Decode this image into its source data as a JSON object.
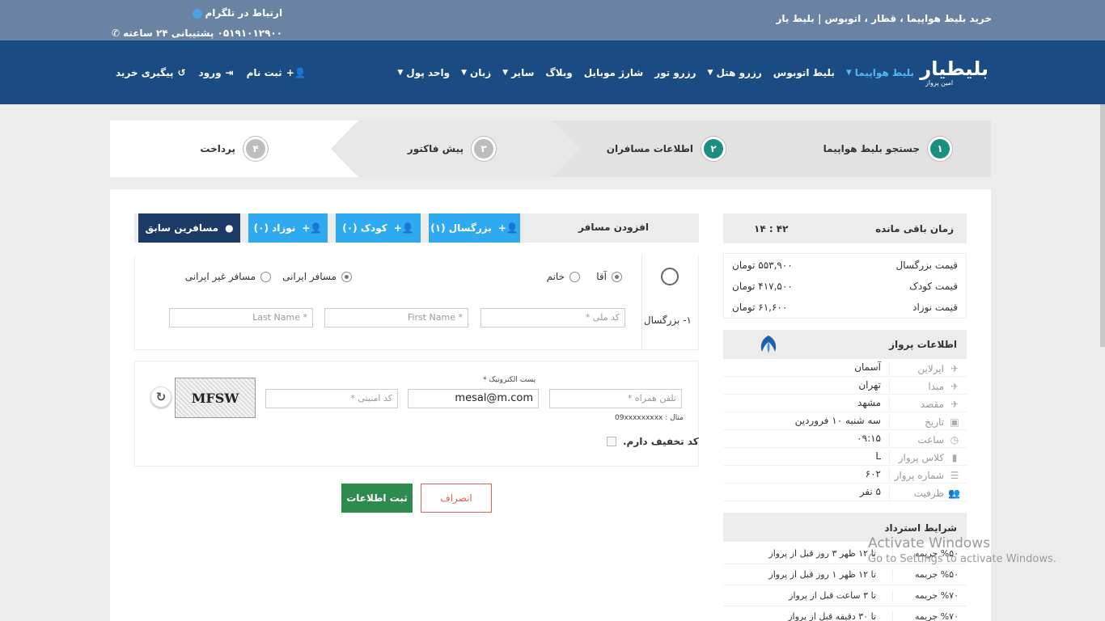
{
  "topbar": {
    "site_title": "خرید بلیط هواپیما ، قطار ، اتوبوس  |  بلیط یار",
    "telegram": "ارتباط در تلگرام",
    "support": "۰۵۱۹۱۰۱۲۹۰۰ پشتیبانی ۲۴ ساعته"
  },
  "logo": {
    "name": "بلیطیار",
    "tagline": "امین پرواز"
  },
  "nav": {
    "items": [
      {
        "label": "بلیط هواپیما",
        "dropdown": true,
        "active": true
      },
      {
        "label": "بلیط اتوبوس",
        "dropdown": false
      },
      {
        "label": "رزرو هتل",
        "dropdown": true
      },
      {
        "label": "رزرو تور",
        "dropdown": false
      },
      {
        "label": "شارژ موبایل",
        "dropdown": false
      },
      {
        "label": "وبلاگ",
        "dropdown": false
      },
      {
        "label": "سایر",
        "dropdown": true
      },
      {
        "label": "زبان",
        "dropdown": true
      },
      {
        "label": "واحد پول",
        "dropdown": true
      }
    ],
    "user": {
      "register": "ثبت نام",
      "login": "ورود",
      "track": "پیگیری خرید"
    }
  },
  "steps": [
    {
      "num": "۱",
      "label": "جستجو بلیط هواپیما",
      "done": true
    },
    {
      "num": "۲",
      "label": "اطلاعات مسافران",
      "done": true
    },
    {
      "num": "۳",
      "label": "پیش فاکتور",
      "done": false
    },
    {
      "num": "۴",
      "label": "پرداخت",
      "done": false
    }
  ],
  "add_passenger": {
    "title": "افزودن مسافر",
    "adult": "بزرگسال (۱)",
    "child": "کودک (۰)",
    "infant": "نوزاد (۰)",
    "previous": "مسافرین سابق"
  },
  "passenger": {
    "label": "۱- بزرگسال",
    "gender_male": "آقا",
    "gender_female": "خانم",
    "iranian": "مسافر ایرانی",
    "foreign": "مسافر غیر ایرانی",
    "national_id_placeholder": "کد ملی *",
    "first_name_placeholder": "First Name *",
    "last_name_placeholder": "Last Name *"
  },
  "contact": {
    "email_label": "پست الکترونیک *",
    "email_value": "mesal@m.com",
    "phone_placeholder": "تلفن همراه *",
    "phone_example": "مثال : 09xxxxxxxxx",
    "security_placeholder": "کد امنیتی *",
    "captcha_text": "MFSW",
    "discount_label": "کد تخفیف دارم."
  },
  "buttons": {
    "submit": "ثبت اطلاعات",
    "cancel": "انصراف"
  },
  "timer": {
    "label": "زمان باقی مانده",
    "value": "۱۴ : ۴۲"
  },
  "prices": [
    {
      "label": "قیمت بزرگسال",
      "value": "۵۵۳,۹۰۰ تومان"
    },
    {
      "label": "قیمت کودک",
      "value": "۴۱۷,۵۰۰ تومان"
    },
    {
      "label": "قیمت نوزاد",
      "value": "۶۱,۶۰۰ تومان"
    }
  ],
  "flight_info": {
    "title": "اطلاعات پرواز",
    "rows": [
      {
        "key": "ایرلاین",
        "value": "آسمان",
        "icon": "plane-icon"
      },
      {
        "key": "مبدا",
        "value": "تهران",
        "icon": "takeoff-icon"
      },
      {
        "key": "مقصد",
        "value": "مشهد",
        "icon": "landing-icon"
      },
      {
        "key": "تاریخ",
        "value": "سه شنبه ۱۰ فروردین",
        "icon": "calendar-icon"
      },
      {
        "key": "ساعت",
        "value": "۰۹:۱۵",
        "icon": "clock-icon"
      },
      {
        "key": "کلاس پرواز",
        "value": "L",
        "icon": "seat-class-icon"
      },
      {
        "key": "شماره پرواز",
        "value": "۶۰۲",
        "icon": "flight-number-icon"
      },
      {
        "key": "ظرفیت",
        "value": "۵ نفر",
        "icon": "people-icon"
      }
    ]
  },
  "refund": {
    "title": "شرایط استرداد",
    "rows": [
      {
        "pct": "%۵۰ جریمه",
        "cond": "تا ۱۲ ظهر ۳ روز قبل از پرواز"
      },
      {
        "pct": "%۵۰ جریمه",
        "cond": "تا ۱۲ ظهر ۱ روز قبل از پرواز"
      },
      {
        "pct": "%۷۰ جریمه",
        "cond": "تا ۳ ساعت قبل از پرواز"
      },
      {
        "pct": "%۷۰ جریمه",
        "cond": "تا ۳۰ دقیقه قبل از پرواز"
      }
    ]
  },
  "watermark": {
    "line1": "Activate Windows",
    "line2": "Go to Settings to activate Windows."
  },
  "colors": {
    "header": "#6b83a3",
    "navbar": "#1a4b82",
    "accent": "#2fa9f0",
    "step_done": "#1a8f82",
    "submit": "#2e8a4d"
  }
}
